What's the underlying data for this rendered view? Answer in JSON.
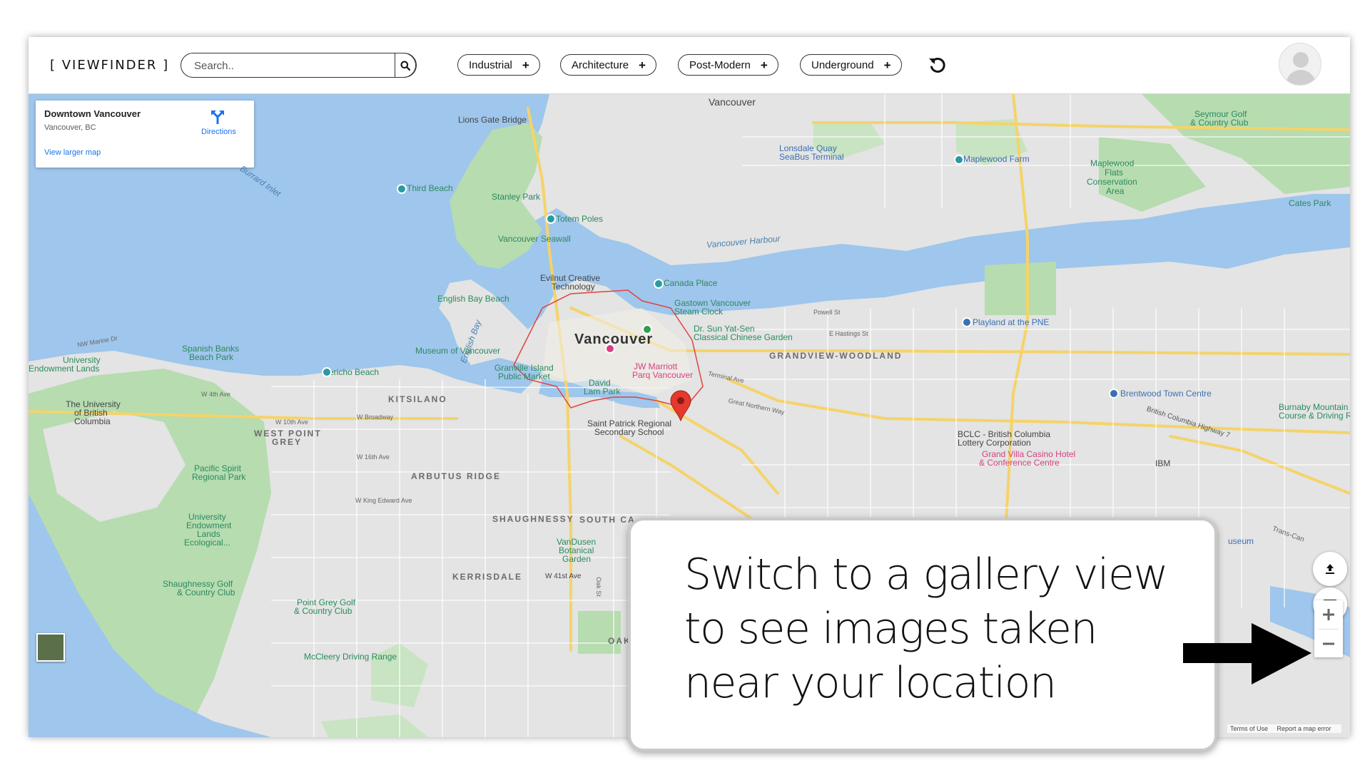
{
  "header": {
    "logo": "[ VIEWFINDER ]",
    "search_placeholder": "Search..",
    "chips": [
      {
        "label": "Industrial"
      },
      {
        "label": "Architecture"
      },
      {
        "label": "Post-Modern"
      },
      {
        "label": "Underground"
      }
    ]
  },
  "info_card": {
    "place": "Downtown Vancouver",
    "address": "Vancouver, BC",
    "directions": "Directions",
    "view_larger": "View larger map"
  },
  "map_labels": {
    "city": "Vancouver",
    "north_vancouver": "Vancouver",
    "water": {
      "burrard_inlet": "Burrard Inlet",
      "vancouver_harbour": "Vancouver Harbour",
      "english_bay": "English Bay"
    },
    "places": {
      "lions_gate": "Lions Gate Bridge",
      "third_beach": "Third Beach",
      "stanley_park": "Stanley Park",
      "totem_poles": "Totem Poles",
      "seawall": "Vancouver Seawall",
      "evilnut_1": "Evilnut Creative",
      "evilnut_2": "Technology",
      "canada_place": "Canada Place",
      "english_bay_beach": "English Bay Beach",
      "gastown_1": "Gastown Vancouver",
      "gastown_2": "Steam Clock",
      "sun_yat_sen_1": "Dr. Sun Yat-Sen",
      "sun_yat_sen_2": "Classical Chinese Garden",
      "museum": "Museum of Vancouver",
      "jericho": "Jericho Beach",
      "granville_1": "Granville Island",
      "granville_2": "Public Market",
      "jw_1": "JW Marriott",
      "jw_2": "Parq Vancouver",
      "david_lam_1": "David",
      "david_lam_2": "Lam Park",
      "lonsdale_1": "Lonsdale Quay",
      "lonsdale_2": "SeaBus Terminal",
      "maplewood_farm": "Maplewood Farm",
      "maplewood_flats_1": "Maplewood",
      "maplewood_flats_2": "Flats",
      "maplewood_flats_3": "Conservation",
      "maplewood_flats_4": "Area",
      "seymour_1": "Seymour Golf",
      "seymour_2": "& Country Club",
      "cates_park": "Cates Park",
      "playland": "Playland at the PNE",
      "brentwood": "Brentwood Town Centre",
      "burnaby_mtn_1": "Burnaby Mountain Gol",
      "burnaby_mtn_2": "Course & Driving Rang",
      "bclc_1": "BCLC - British Columbia",
      "bclc_2": "Lottery Corporation",
      "grand_villa_1": "Grand Villa Casino Hotel",
      "grand_villa_2": "& Conference Centre",
      "ibm": "IBM",
      "spanish_banks_1": "Spanish Banks",
      "spanish_banks_2": "Beach Park",
      "university_1": "University",
      "university_2": "Endowment Lands",
      "ubc_1": "The University",
      "ubc_2": "of British",
      "ubc_3": "Columbia",
      "pacific_spirit_1": "Pacific Spirit",
      "pacific_spirit_2": "Regional Park",
      "uel_1": "University",
      "uel_2": "Endowment",
      "uel_3": "Lands",
      "uel_4": "Ecological...",
      "shaughnessy_golf_1": "Shaughnessy Golf",
      "shaughnessy_golf_2": "& Country Club",
      "point_grey_golf_1": "Point Grey Golf",
      "point_grey_golf_2": "& Country Club",
      "mccleery": "McCleery Driving Range",
      "st_patrick_1": "Saint Patrick Regional",
      "st_patrick_2": "Secondary School",
      "vandusen_1": "VanDusen",
      "vandusen_2": "Botanical",
      "vandusen_3": "Garden",
      "museum_partial": "useum"
    },
    "districts": {
      "kitsilano": "KITSILANO",
      "west_point_grey_1": "WEST POINT",
      "west_point_grey_2": "GREY",
      "arbutus_ridge": "ARBUTUS RIDGE",
      "shaughnessy": "SHAUGHNESSY",
      "south_cambie": "SOUTH CA",
      "kerrisdale": "KERRISDALE",
      "grandview": "GRANDVIEW-WOODLAND",
      "oakridge": "OAK"
    },
    "streets": {
      "e_hastings": "E Hastings St",
      "w_4th": "W 4th Ave",
      "w_broadway": "W Broadway",
      "w_10th": "W 10th Ave",
      "w_16th": "W 16th Ave",
      "w_41st": "W 41st Ave",
      "w_king_edward": "W King Edward Ave",
      "bc_highway_7": "British Columbia Highway 7",
      "terminal": "Terminal Ave",
      "great_northern": "Great Northern Way",
      "marine_dr": "NW Marine Dr",
      "powell": "Powell St",
      "oak_st": "Oak St",
      "trans_can": "Trans-Can"
    }
  },
  "map_footer": {
    "terms": "Terms of Use",
    "report": "Report a map error"
  },
  "callout": {
    "text": "Switch to a gallery view to see images taken near your location"
  },
  "colors": {
    "water": "#9fc6ec",
    "park": "#b6dcb0",
    "land": "#e3e4e3",
    "road_highway": "#f5d36a",
    "accent_blue": "#1a73e8",
    "pin_red": "#e5392e"
  },
  "icons": {
    "search": "search-icon",
    "refresh": "refresh-icon",
    "directions": "directions-icon",
    "upload": "upload-icon",
    "gallery": "image-gallery-icon",
    "zoom_in": "plus-icon",
    "zoom_out": "minus-icon"
  }
}
